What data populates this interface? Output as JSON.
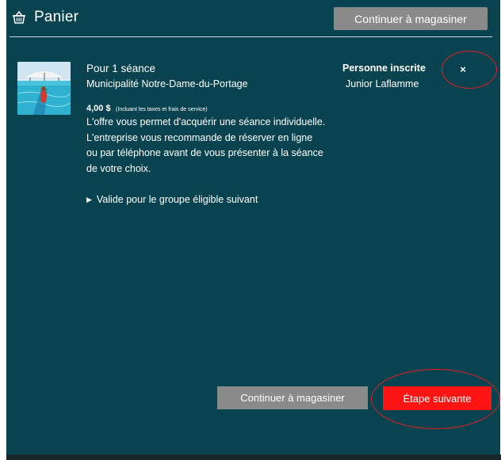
{
  "header": {
    "title": "Panier",
    "icon": "basket-icon",
    "continue_label": "Continuer à magasiner"
  },
  "item": {
    "title": "Pour 1 séance",
    "municipality": "Municipalité Notre-Dame-du-Portage",
    "price": "4,00 $",
    "price_note": "(Incluant les taxes et frais de service)",
    "description": "L'offre vous permet d'acquérir une séance individuelle. L'entreprise vous recommande de réserver en ligne ou par téléphone avant de vous présenter à la séance de votre choix.",
    "eligible_group_toggle": "Valide pour le groupe éligible suivant",
    "registrant_label": "Personne inscrite",
    "registrant_name": "Junior Laflamme",
    "remove_symbol": "×"
  },
  "footer": {
    "continue_label": "Continuer à magasiner",
    "next_label": "Étape suivante"
  },
  "colors": {
    "panel_background": "#0a4350",
    "gray_button": "#8a8a8a",
    "next_button": "#ff1414",
    "annotation_ring": "#e01f1f"
  }
}
